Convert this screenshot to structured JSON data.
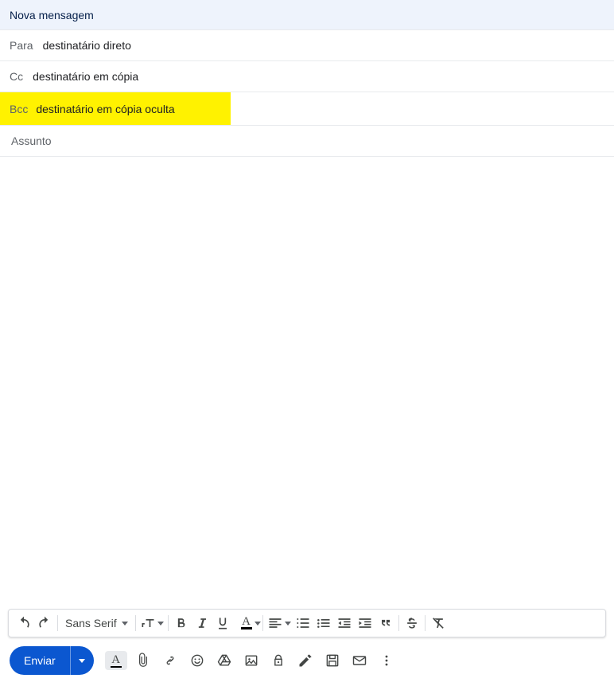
{
  "header": {
    "title": "Nova mensagem"
  },
  "fields": {
    "to_label": "Para",
    "to_value": "destinatário direto",
    "cc_label": "Cc",
    "cc_value": "destinatário em cópia",
    "bcc_label": "Bcc",
    "bcc_value": "destinatário em cópia oculta",
    "subject_placeholder": "Assunto",
    "subject_value": ""
  },
  "format": {
    "font": "Sans Serif"
  },
  "send": {
    "label": "Enviar"
  }
}
